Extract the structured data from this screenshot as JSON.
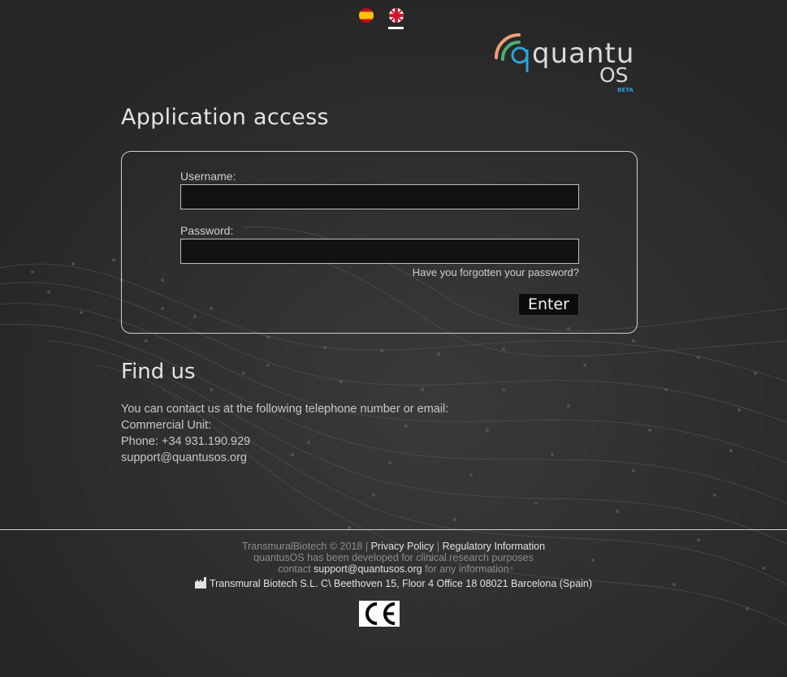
{
  "languages": [
    {
      "code": "es",
      "icon": "spain-flag-icon",
      "active": false
    },
    {
      "code": "en",
      "icon": "uk-flag-icon",
      "active": true
    }
  ],
  "logo": {
    "name": "quantus",
    "suffix": "OS",
    "badge": "BETA",
    "colors": {
      "arc_orange": "#f0a078",
      "arc_green": "#4caf7a",
      "q_blue": "#29a6d9",
      "badge": "#2aa0d6"
    }
  },
  "login": {
    "title": "Application access",
    "username_label": "Username:",
    "username_value": "",
    "password_label": "Password:",
    "password_value": "",
    "forgot_link": "Have you forgotten your password?",
    "enter_button": "Enter"
  },
  "findus": {
    "title": "Find us",
    "intro": "You can contact us at the following telephone number or email:",
    "unit": "Commercial Unit:",
    "phone": "Phone: +34 931.190.929",
    "email": "support@quantusos.org"
  },
  "footer": {
    "copyright": "TransmuralBiotech © 2018 |",
    "privacy": "Privacy Policy",
    "separator": "|",
    "regulatory": "Regulatory Information",
    "developed": "quantusOS has been developed for clinical research purposes",
    "contact_prefix": "contact",
    "contact_email": "support@quantusos.org",
    "contact_suffix": "for any information",
    "address": "Transmural Biotech S.L. C\\ Beethoven 15, Floor 4 Office 18 08021 Barcelona (Spain)",
    "ce_icon": "ce-mark-icon"
  }
}
